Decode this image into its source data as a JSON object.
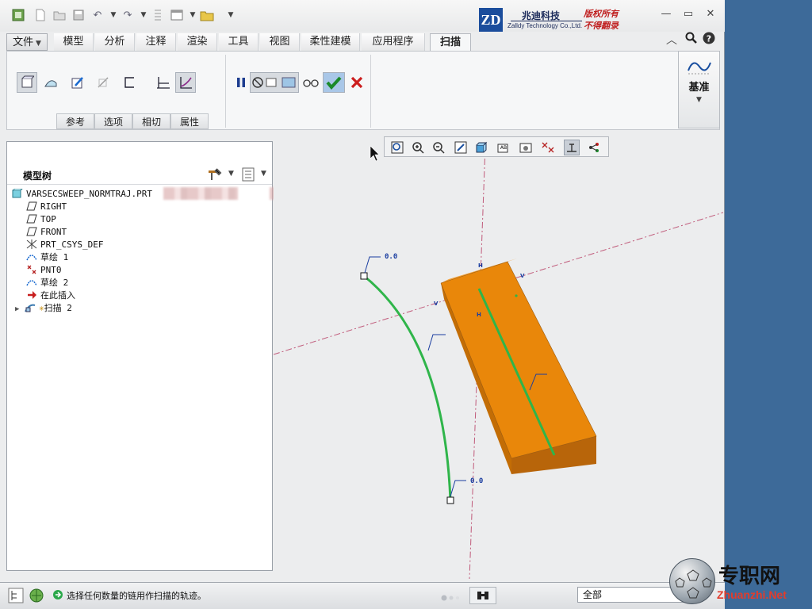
{
  "brand": {
    "name_cn": "兆迪科技",
    "name_en": "Zalldy Technology Co.,Ltd.",
    "rights_line1": "版权所有",
    "rights_line2": "不得翻录",
    "logo_text": "ZD"
  },
  "ribbon_tabs": [
    "文件",
    "模型",
    "分析",
    "注释",
    "渲染",
    "工具",
    "视图",
    "柔性建模",
    "应用程序",
    "扫描"
  ],
  "ribbon_subtabs": [
    "参考",
    "选项",
    "相切",
    "属性"
  ],
  "datum_group": {
    "label": "基准"
  },
  "model_tree": {
    "title": "模型树",
    "items": [
      {
        "label": "VARSECSWEEP_NORMTRAJ.PRT",
        "icon": "part-icon"
      },
      {
        "label": "RIGHT",
        "icon": "datum-plane-icon"
      },
      {
        "label": "TOP",
        "icon": "datum-plane-icon"
      },
      {
        "label": "FRONT",
        "icon": "datum-plane-icon"
      },
      {
        "label": "PRT_CSYS_DEF",
        "icon": "csys-icon"
      },
      {
        "label": "草绘 1",
        "icon": "sketch-icon"
      },
      {
        "label": "PNT0",
        "icon": "datum-point-icon"
      },
      {
        "label": "草绘 2",
        "icon": "sketch-icon"
      },
      {
        "label": "在此插入",
        "icon": "insert-here-arrow-icon"
      },
      {
        "label": "扫描 2",
        "icon": "sweep-icon"
      }
    ]
  },
  "viewport": {
    "dim_labels": [
      "0.0",
      "0.0"
    ],
    "colors": {
      "body": "#e9870a",
      "trajectory": "#2fb54a",
      "axis": "#c05a7a"
    }
  },
  "status": {
    "message": "选择任何数量的链用作扫描的轨迹。",
    "filter": "全部"
  },
  "watermark": {
    "cn": "专职网",
    "url": "Zhuanzhi.Net"
  }
}
